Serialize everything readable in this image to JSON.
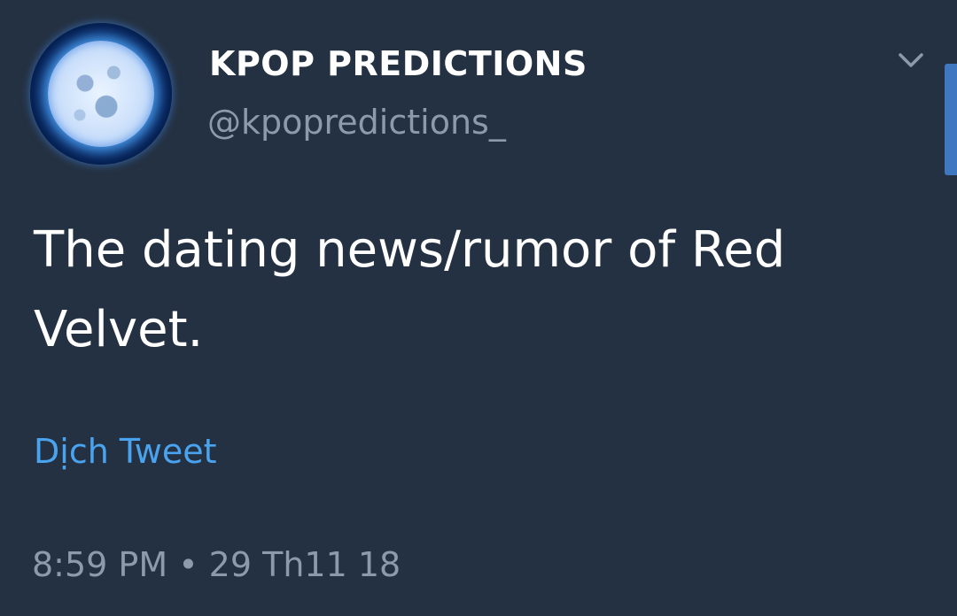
{
  "tweet": {
    "display_name": "KPOP PREDICTIONS",
    "handle": "@kpopredictions_",
    "text": "The dating news/rumor of Red Velvet.",
    "translate_label": "Dịch Tweet",
    "timestamp": "8:59 PM • 29 Th11 18",
    "avatar_icon": "moon-avatar",
    "menu_icon": "chevron-down-icon"
  },
  "colors": {
    "background": "#243142",
    "text": "#ffffff",
    "secondary_text": "#8c9bab",
    "link": "#4aa3ef",
    "scroll_accent": "#3f78c0"
  }
}
